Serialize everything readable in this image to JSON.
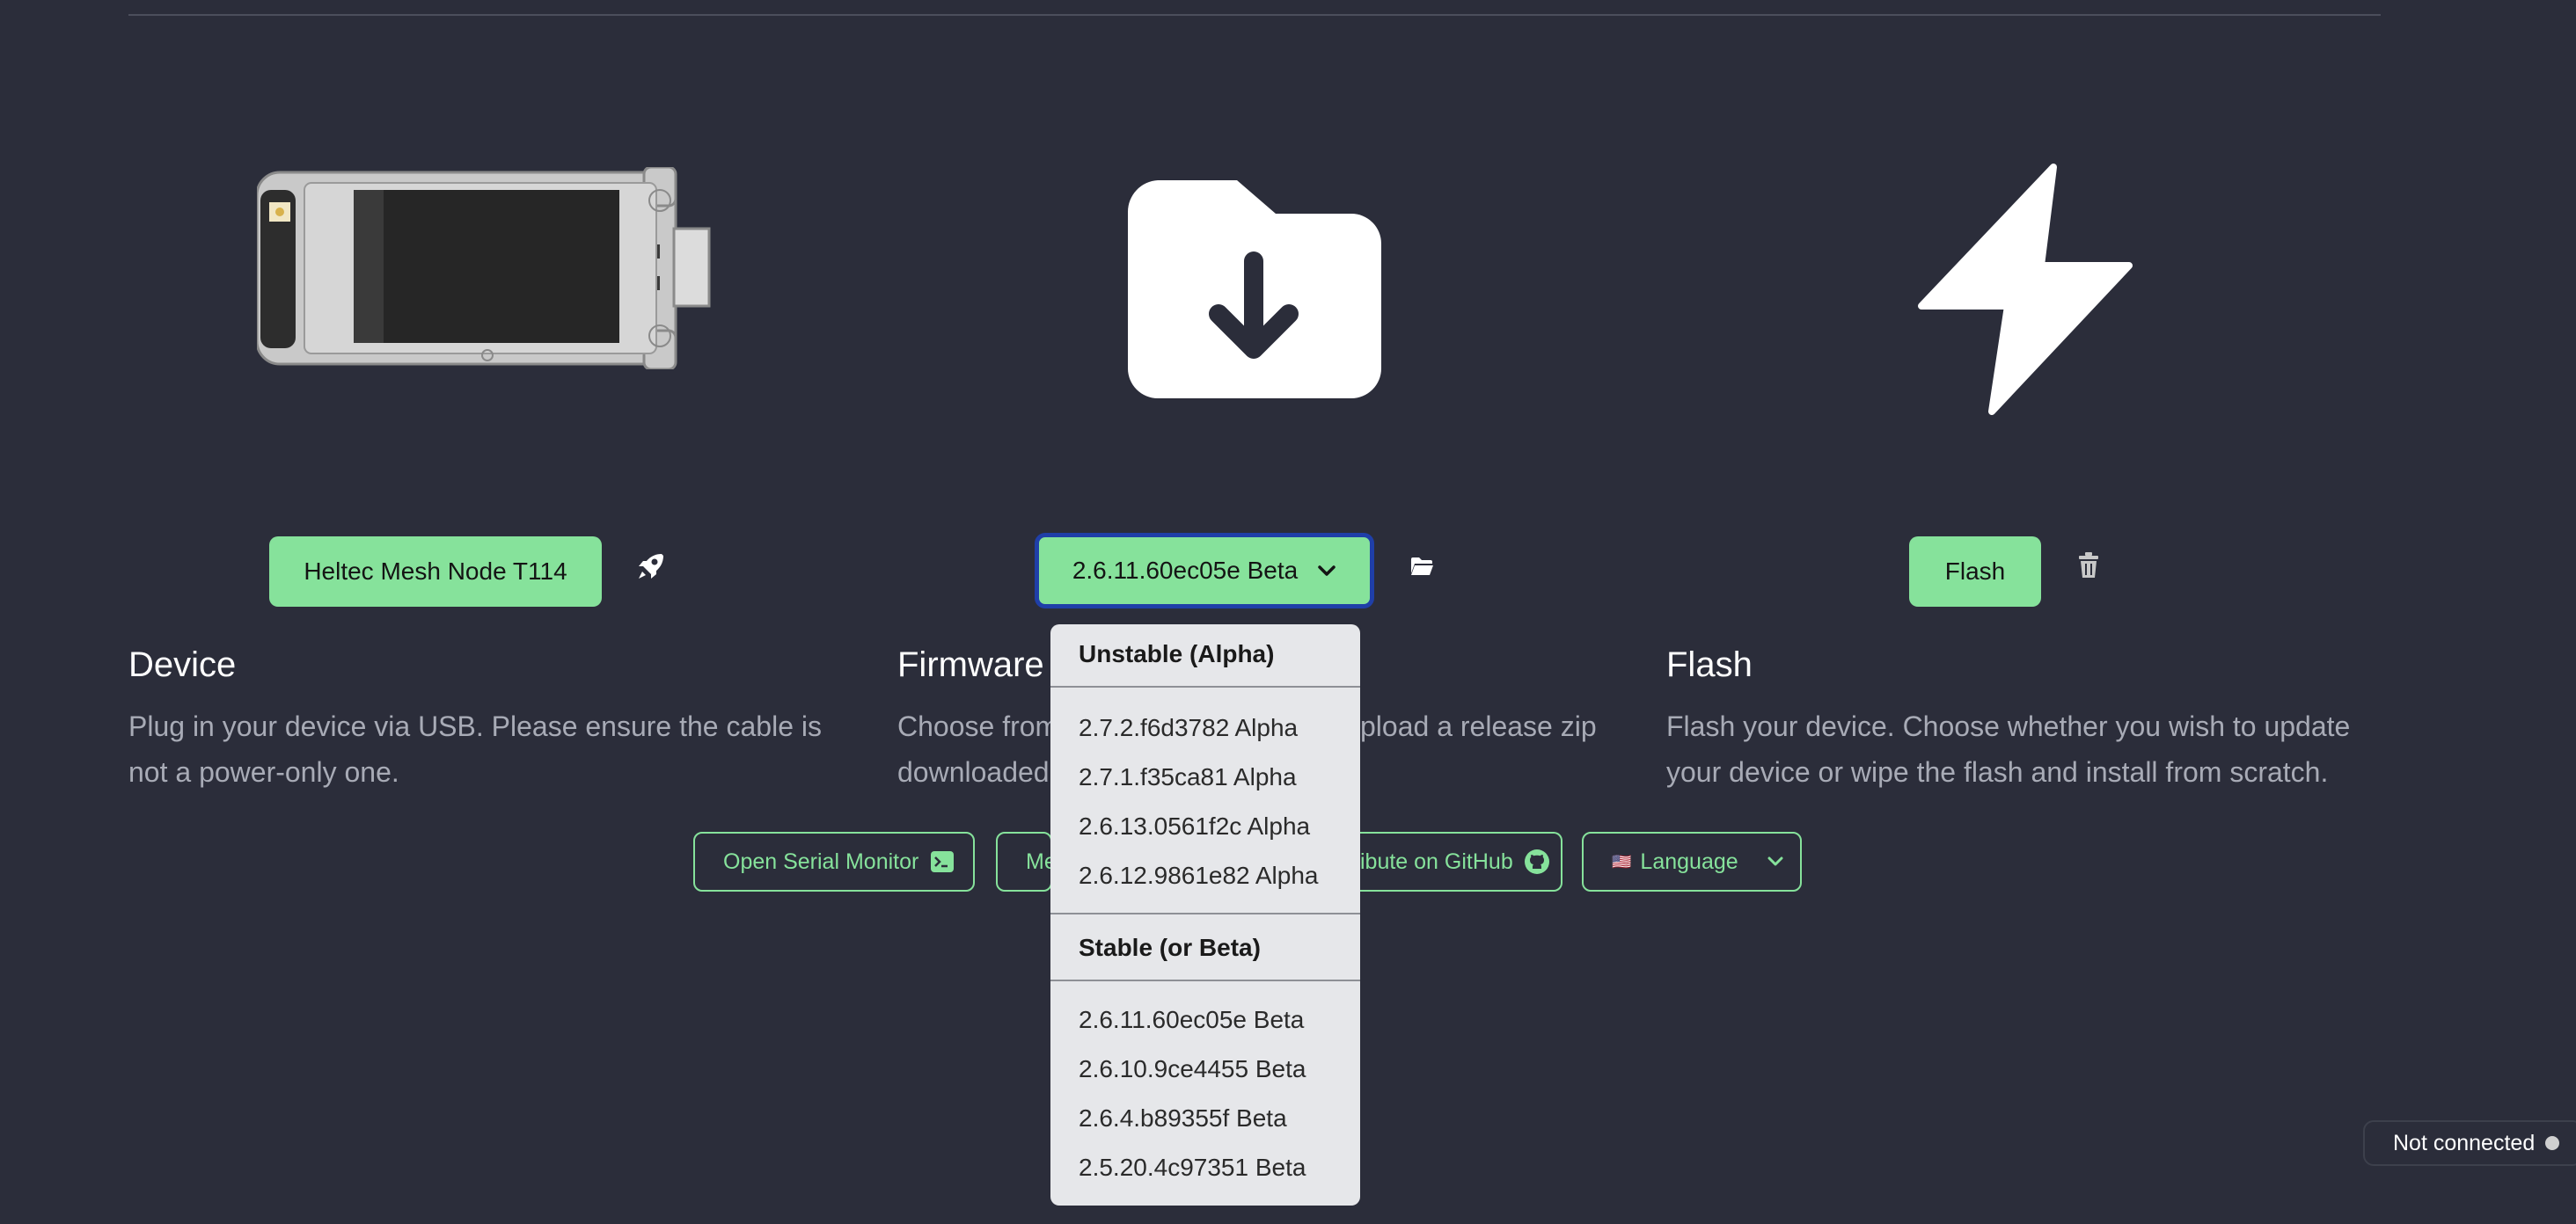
{
  "device": {
    "selected": "Heltec Mesh Node T114",
    "title": "Device",
    "description": "Plug in your device via USB. Please ensure the cable is not a power-only one."
  },
  "firmware": {
    "selected": "2.6.11.60ec05e Beta",
    "title": "Firmware",
    "description_left": "Choose from",
    "description_left_2": "downloaded",
    "description_right": "pload a release zip"
  },
  "flash": {
    "button_label": "Flash",
    "title": "Flash",
    "description": "Flash your device. Choose whether you wish to update your device or wipe the flash and install from scratch."
  },
  "dropdown": {
    "groups": [
      {
        "label": "Unstable (Alpha)",
        "items": [
          "2.7.2.f6d3782 Alpha",
          "2.7.1.f35ca81 Alpha",
          "2.6.13.0561f2c Alpha",
          "2.6.12.9861e82 Alpha"
        ]
      },
      {
        "label": "Stable (or Beta)",
        "items": [
          "2.6.11.60ec05e Beta",
          "2.6.10.9ce4455 Beta",
          "2.6.4.b89355f Beta",
          "2.5.20.4c97351 Beta"
        ]
      }
    ]
  },
  "footer": {
    "serial_monitor": "Open Serial Monitor",
    "meshtastic_partial": "Me",
    "github_partial": "ibute on GitHub",
    "language": "Language",
    "language_flag": "🇺🇸"
  },
  "status": {
    "text": "Not connected"
  },
  "colors": {
    "background": "#2b2d3a",
    "accent": "#86e29b",
    "focus_ring": "#1f3fa8"
  }
}
